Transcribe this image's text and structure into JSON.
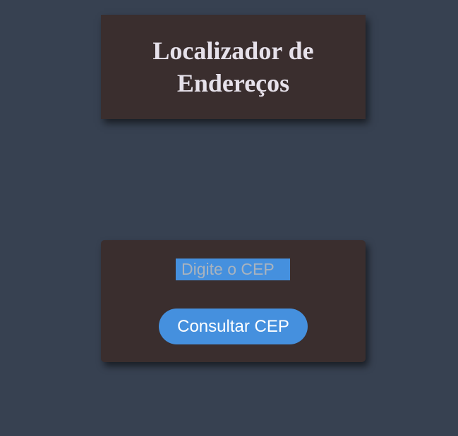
{
  "header": {
    "title": "Localizador de Endereços"
  },
  "form": {
    "cep_placeholder": "Digite o CEP",
    "cep_value": "",
    "submit_label": "Consultar CEP"
  },
  "colors": {
    "background": "#374151",
    "card": "#3a2e2e",
    "accent": "#4590de",
    "title_text": "#e6e1ea"
  }
}
